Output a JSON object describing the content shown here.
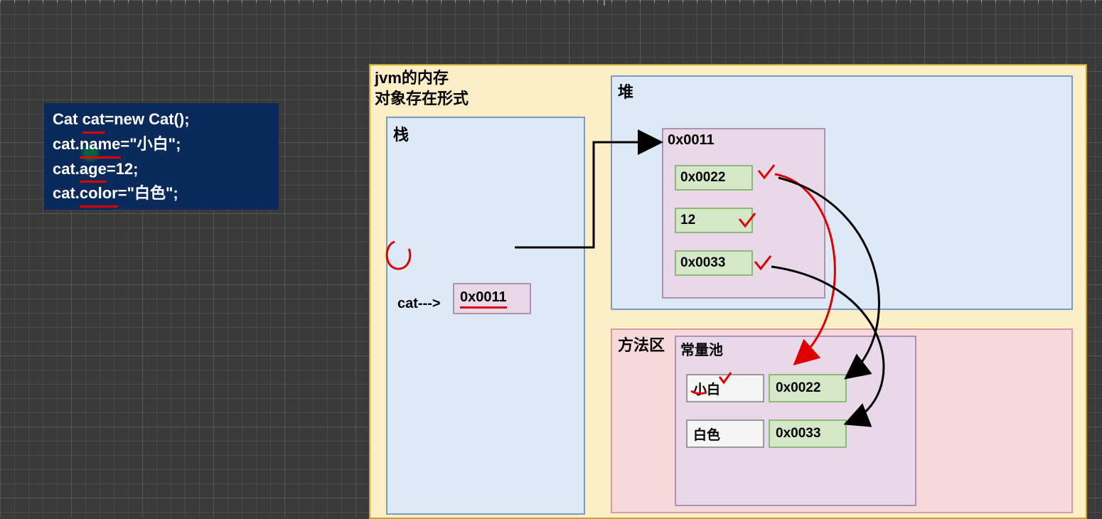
{
  "code": {
    "line1_pre": "Cat ",
    "line1_mid": "cat",
    "line1_post": "=new Cat();",
    "line2_pre": "cat.",
    "line2_mid": "name",
    "line2_post": "=\"小白\";",
    "line3_pre": "cat.",
    "line3_mid": "age",
    "line3_post": "=12;",
    "line4_pre": "cat.",
    "line4_mid": "color",
    "line4_post": "=\"白色\";"
  },
  "panel": {
    "title_line1": "jvm的内存",
    "title_line2": "对象存在形式"
  },
  "stack": {
    "title": "栈",
    "var_name": "cat--->",
    "var_value": "0x0011"
  },
  "heap": {
    "title": "堆",
    "obj_addr": "0x0011",
    "fields": [
      "0x0022",
      "12",
      "0x0033"
    ]
  },
  "method_area": {
    "title": "方法区",
    "pool_title": "常量池",
    "rows": [
      {
        "name": "小白",
        "addr": "0x0022"
      },
      {
        "name": "白色",
        "addr": "0x0033"
      }
    ]
  }
}
